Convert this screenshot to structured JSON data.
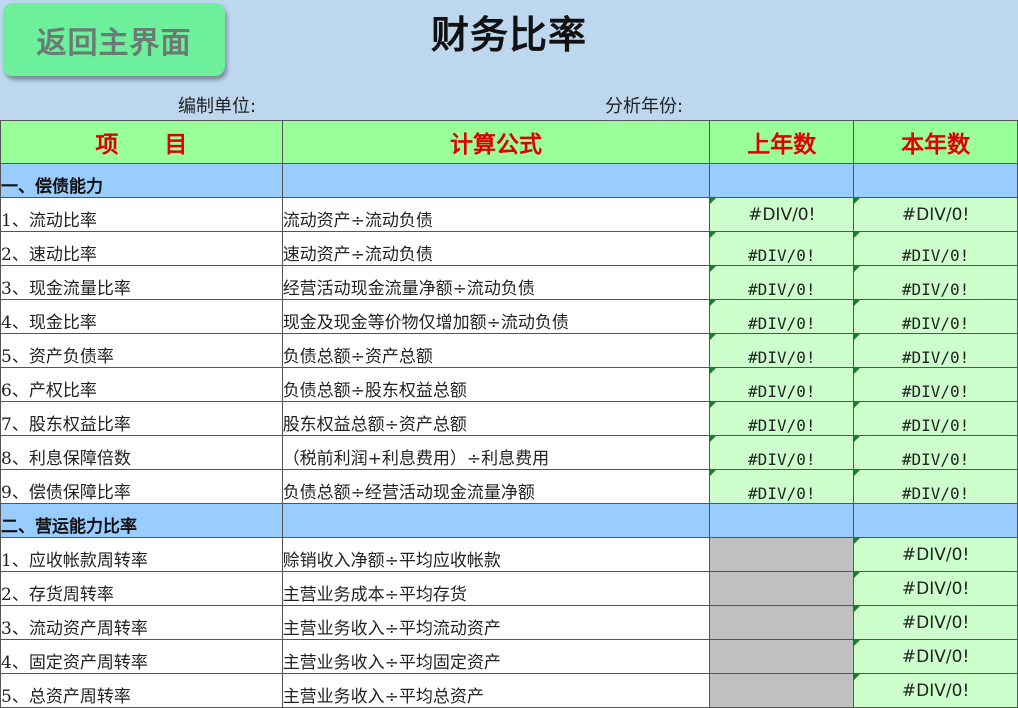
{
  "header": {
    "back_button": "返回主界面",
    "title": "财务比率",
    "unit_label": "编制单位:",
    "year_label": "分析年份:"
  },
  "columns": [
    "项　　目",
    "计算公式",
    "上年数",
    "本年数"
  ],
  "sections": [
    {
      "title": "一、偿债能力",
      "rows": [
        {
          "name": "1、流动比率",
          "formula": "流动资产÷流动负债",
          "prev": "#DIV/0!",
          "curr": "#DIV/0!",
          "prev_gray": false
        },
        {
          "name": "2、速动比率",
          "formula": "速动资产÷流动负债",
          "prev": "#DIV/0!",
          "curr": "#DIV/0!",
          "prev_gray": false
        },
        {
          "name": "3、现金流量比率",
          "formula": "经营活动现金流量净额÷流动负债",
          "prev": "#DIV/0!",
          "curr": "#DIV/0!",
          "prev_gray": false
        },
        {
          "name": "4、现金比率",
          "formula": "现金及现金等价物仅增加额÷流动负债",
          "prev": "#DIV/0!",
          "curr": "#DIV/0!",
          "prev_gray": false
        },
        {
          "name": "5、资产负债率",
          "formula": "负债总额÷资产总额",
          "prev": "#DIV/0!",
          "curr": "#DIV/0!",
          "prev_gray": false
        },
        {
          "name": "6、产权比率",
          "formula": "负债总额÷股东权益总额",
          "prev": "#DIV/0!",
          "curr": "#DIV/0!",
          "prev_gray": false
        },
        {
          "name": "7、股东权益比率",
          "formula": "股东权益总额÷资产总额",
          "prev": "#DIV/0!",
          "curr": "#DIV/0!",
          "prev_gray": false
        },
        {
          "name": "8、利息保障倍数",
          "formula": "（税前利润+利息费用）÷利息费用",
          "prev": "#DIV/0!",
          "curr": "#DIV/0!",
          "prev_gray": false
        },
        {
          "name": "9、偿债保障比率",
          "formula": "负债总额÷经营活动现金流量净额",
          "prev": "#DIV/0!",
          "curr": "#DIV/0!",
          "prev_gray": false
        }
      ]
    },
    {
      "title": "二、营运能力比率",
      "rows": [
        {
          "name": "1、应收帐款周转率",
          "formula": "赊销收入净额÷平均应收帐款",
          "prev": "",
          "curr": "#DIV/0!",
          "prev_gray": true
        },
        {
          "name": "2、存货周转率",
          "formula": "主营业务成本÷平均存货",
          "prev": "",
          "curr": "#DIV/0!",
          "prev_gray": true
        },
        {
          "name": "3、流动资产周转率",
          "formula": "主营业务收入÷平均流动资产",
          "prev": "",
          "curr": "#DIV/0!",
          "prev_gray": true
        },
        {
          "name": "4、固定资产周转率",
          "formula": "主营业务收入÷平均固定资产",
          "prev": "",
          "curr": "#DIV/0!",
          "prev_gray": true
        },
        {
          "name": "5、总资产周转率",
          "formula": "主营业务收入÷平均总资产",
          "prev": "",
          "curr": "#DIV/0!",
          "prev_gray": true
        }
      ]
    }
  ]
}
